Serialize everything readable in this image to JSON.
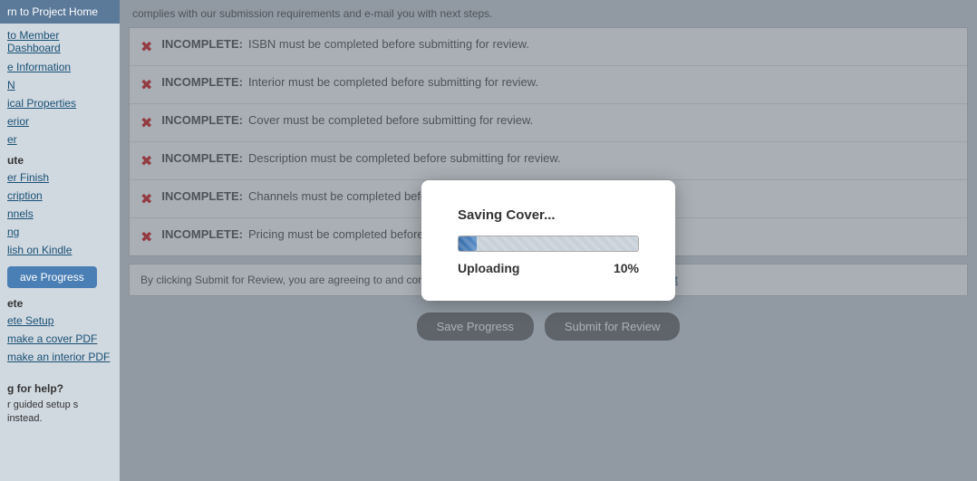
{
  "sidebar": {
    "nav_top": "rn to Project Home",
    "member_dashboard": "to Member Dashboard",
    "links": [
      {
        "label": "e Information",
        "name": "book-information-link"
      },
      {
        "label": "N",
        "name": "isbn-link"
      },
      {
        "label": "ical Properties",
        "name": "physical-properties-link"
      },
      {
        "label": "erior",
        "name": "interior-link"
      },
      {
        "label": "er",
        "name": "cover-link"
      }
    ],
    "distribute_label": "ute",
    "distribute_items": [
      {
        "label": "er Finish",
        "name": "cover-finish-link"
      },
      {
        "label": "cription",
        "name": "description-link"
      },
      {
        "label": "nnels",
        "name": "channels-link"
      },
      {
        "label": "ng",
        "name": "pricing-link"
      },
      {
        "label": "lish on Kindle",
        "name": "publish-kindle-link"
      }
    ],
    "save_progress_btn": "ave Progress",
    "complete_label": "ete",
    "complete_setup_link": "ete Setup",
    "make_cover_pdf": "make a cover PDF",
    "make_interior_pdf": "make an interior PDF",
    "help_title": "g for help?",
    "help_text": "r guided setup\ns instead."
  },
  "main": {
    "intro_text": "complies with our submission requirements and e-mail you with next steps.",
    "checklist_items": [
      {
        "label": "INCOMPLETE:",
        "text": "ISBN must be completed before submitting for review."
      },
      {
        "label": "INCOMPLETE:",
        "text": "Interior must be completed before submitting for review."
      },
      {
        "label": "INCOMPLETE:",
        "text": "Cover must be completed before submitting for review."
      },
      {
        "label": "INCOMPLETE:",
        "text": "Description must be completed before submitting for review."
      },
      {
        "label": "INCOMPLETE:",
        "text": "Channels must be completed before submitting for review."
      },
      {
        "label": "INCOMPLETE:",
        "text": "Pricing must be completed before submitting for review."
      }
    ],
    "agreement_text": "By clicking Submit for Review, you are agreeing to and confirming your compliance with the ",
    "agreement_link": "Member Agreement",
    "save_progress_btn": "Save Progress",
    "submit_review_btn": "Submit for Review"
  },
  "modal": {
    "title_prefix": "Saving ",
    "title_bold": "Cover",
    "title_suffix": "...",
    "status_label": "Uploading",
    "progress_percent": 10,
    "progress_display": "10%"
  }
}
